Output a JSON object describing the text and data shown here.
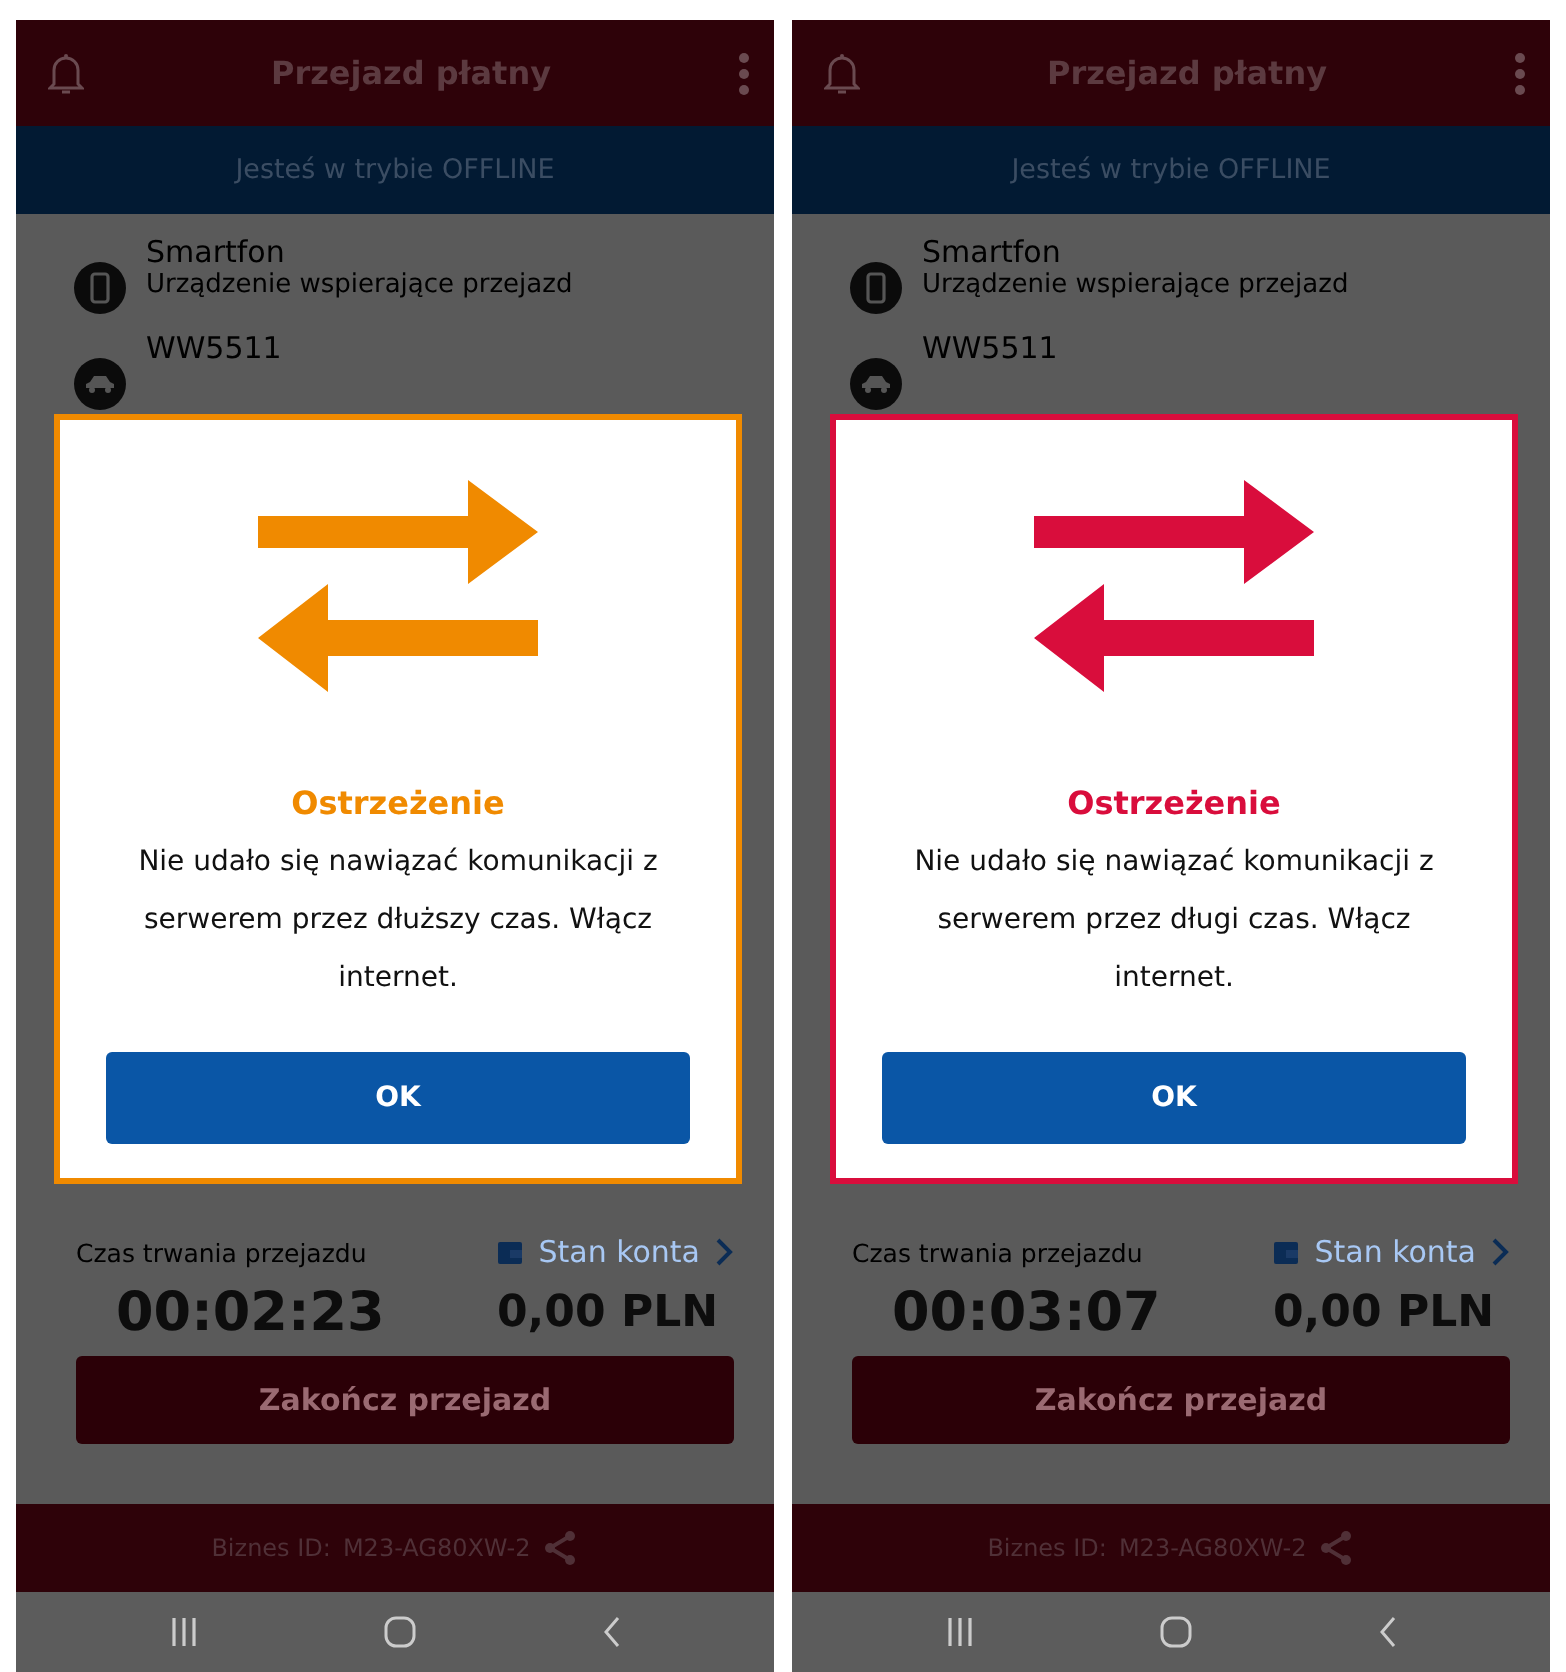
{
  "phones": [
    {
      "header": {
        "title": "Przejazd płatny"
      },
      "offline_banner": "Jesteś w trybie OFFLINE",
      "devices": [
        {
          "kind": "phone",
          "name": "Smartfon",
          "description": "Urządzenie wspierające przejazd"
        },
        {
          "kind": "car",
          "name": "WW5511"
        }
      ],
      "dialog": {
        "color": "#f08a00",
        "title": "Ostrzeżenie",
        "message": "Nie udało się nawiązać komunikacji z serwerem przez dłuższy czas. Włącz internet.",
        "button": "OK"
      },
      "duration_label": "Czas trwania przejazdu",
      "account_link": "Stan konta",
      "duration": "00:02:23",
      "amount": "0,00 PLN",
      "end_button": "Zakończ przejazd",
      "business_id_label": "Biznes ID:",
      "business_id": "M23-AG80XW-2"
    },
    {
      "header": {
        "title": "Przejazd płatny"
      },
      "offline_banner": "Jesteś w trybie OFFLINE",
      "devices": [
        {
          "kind": "phone",
          "name": "Smartfon",
          "description": "Urządzenie wspierające przejazd"
        },
        {
          "kind": "car",
          "name": "WW5511"
        }
      ],
      "dialog": {
        "color": "#d90d3c",
        "title": "Ostrzeżenie",
        "message": "Nie udało się nawiązać komunikacji z serwerem przez długi czas. Włącz internet.",
        "button": "OK"
      },
      "duration_label": "Czas trwania przejazdu",
      "account_link": "Stan konta",
      "duration": "00:03:07",
      "amount": "0,00 PLN",
      "end_button": "Zakończ przejazd",
      "business_id_label": "Biznes ID:",
      "business_id": "M23-AG80XW-2"
    }
  ]
}
